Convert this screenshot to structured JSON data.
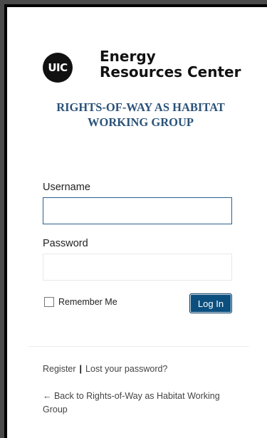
{
  "logo": {
    "badge_text": "UIC",
    "org_line1": "Energy",
    "org_line2": "Resources Center"
  },
  "heading": {
    "line1": "RIGHTS-OF-WAY AS HABITAT",
    "line2": "WORKING GROUP"
  },
  "form": {
    "username_label": "Username",
    "username_value": "",
    "password_label": "Password",
    "password_value": "",
    "remember_label": "Remember Me",
    "remember_checked": false,
    "login_button": "Log In"
  },
  "links": {
    "register": "Register",
    "separator": "|",
    "lost_password": "Lost your password?",
    "back": "← Back to Rights-of-Way as Habitat Working Group"
  },
  "colors": {
    "accent": "#0b4f7e",
    "heading": "#2a5279"
  }
}
